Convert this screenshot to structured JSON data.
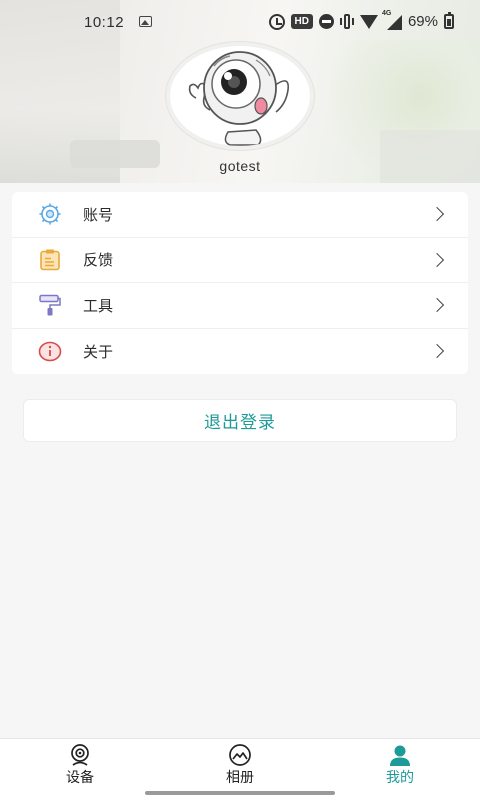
{
  "status_bar": {
    "time": "10:12",
    "hd": "HD",
    "network": "4G",
    "battery_percent": "69%",
    "icons": [
      "image-icon",
      "alarm-icon",
      "dnd-icon",
      "vibrate-icon",
      "wifi-icon",
      "signal-icon",
      "battery-icon"
    ]
  },
  "profile": {
    "username": "gotest",
    "avatar_icon": "cartoon-eyeball-avatar"
  },
  "menu": {
    "items": [
      {
        "label": "账号",
        "icon": "account-gear-icon"
      },
      {
        "label": "反馈",
        "icon": "feedback-note-icon"
      },
      {
        "label": "工具",
        "icon": "paint-roller-icon"
      },
      {
        "label": "关于",
        "icon": "info-icon"
      }
    ]
  },
  "logout": {
    "label": "退出登录"
  },
  "bottom_nav": {
    "tabs": [
      {
        "label": "设备",
        "icon": "camera-device-icon",
        "active": false
      },
      {
        "label": "相册",
        "icon": "album-icon",
        "active": false
      },
      {
        "label": "我的",
        "icon": "person-icon",
        "active": true
      }
    ]
  },
  "colors": {
    "accent": "#1E9A98",
    "background": "#F6F6F6",
    "card": "#FFFFFF",
    "text": "#2B2B2B"
  }
}
